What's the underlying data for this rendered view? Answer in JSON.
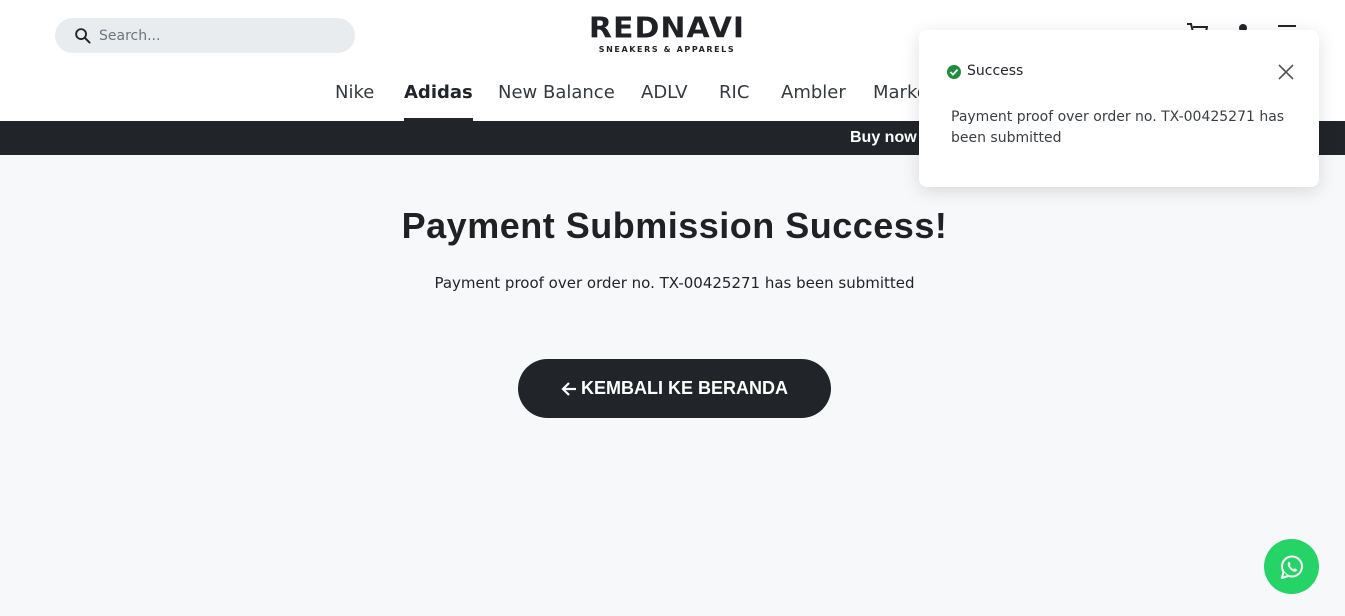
{
  "header": {
    "search": {
      "placeholder": "Search..."
    },
    "logo": {
      "main": "REDNAVI",
      "sub": "SNEAKERS & APPARELS"
    },
    "icons": [
      "cart-icon",
      "user-icon",
      "menu-icon"
    ]
  },
  "nav": {
    "items": [
      {
        "label": "Nike"
      },
      {
        "label": "Adidas",
        "active": true
      },
      {
        "label": "New Balance"
      },
      {
        "label": "ADLV"
      },
      {
        "label": "RIC"
      },
      {
        "label": "Ambler"
      },
      {
        "label": "Marke"
      }
    ]
  },
  "promo": {
    "text": "Buy now"
  },
  "main": {
    "title": "Payment Submission Success!",
    "message": "Payment proof over order no. TX-00425271 has been submitted",
    "back_button": "KEMBALI KE BERANDA"
  },
  "toast": {
    "title": "Success",
    "message": "Payment proof over order no. TX-00425271 has been submitted"
  },
  "colors": {
    "dark": "#212529",
    "success": "#1e8e3e",
    "whatsapp": "#25d366",
    "page_bg": "#f7f8fa"
  }
}
